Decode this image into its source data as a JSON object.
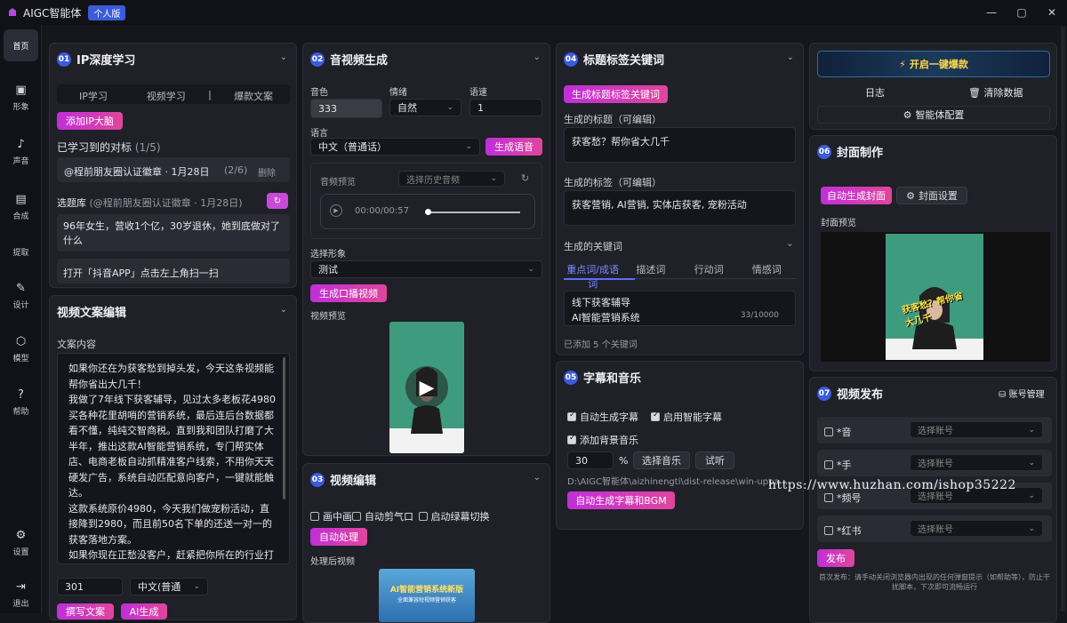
{
  "app": {
    "title": "AIGC智能体",
    "edition": "个人版"
  },
  "sidebar": {
    "items": [
      {
        "label": "首页",
        "icon": "home-icon"
      },
      {
        "label": "形象",
        "icon": "avatar-icon"
      },
      {
        "label": "声音",
        "icon": "sound-icon"
      },
      {
        "label": "合成",
        "icon": "compose-icon"
      },
      {
        "label": "提取",
        "icon": "extract-icon"
      },
      {
        "label": "设计",
        "icon": "pen-icon"
      },
      {
        "label": "模型",
        "icon": "cube-icon"
      },
      {
        "label": "帮助",
        "icon": "help-icon"
      },
      {
        "label": "设置",
        "icon": "gear-icon"
      },
      {
        "label": "退出",
        "icon": "logout-icon"
      }
    ]
  },
  "ip": {
    "num": "01",
    "title": "IP深度学习",
    "tabs": [
      "IP学习",
      "视频学习",
      "|",
      "爆款文案"
    ],
    "add_button": "添加IP大脑",
    "target_label": "已学习到的对标",
    "target_count": "(1/5)",
    "target_item": "@程前朋友圈认证徽章 · 1月28日",
    "target_progress": "(2/6)",
    "delete_label": "删除",
    "topic_label": "选题库",
    "topic_source": "(@程前朋友圈认证徽章 · 1月28日)",
    "topic_1": "96年女生，营收1个亿，30岁退休，她到底做对了什么",
    "topic_2": "打开「抖音APP」点击左上角扫一扫"
  },
  "copy_edit": {
    "title": "视频文案编辑",
    "content_label": "文案内容",
    "content": "如果你还在为获客愁到掉头发，今天这条视频能帮你省出大几千！\n我做了7年线下获客辅导，见过太多老板花4980买各种花里胡哨的营销系统，最后连后台数据都看不懂，纯纯交智商税。直到我和团队打磨了大半年，推出这款AI智能营销系统，专门帮实体店、电商老板自动抓精准客户线索，不用你天天硬发广告，系统自动匹配意向客户，一键就能触达。\n这款系统原价4980，今天我们做宠粉活动，直接降到2980，而且前50名下单的还送一对一的获客落地方案。\n如果你现在正愁没客户，赶紧把你所在的行业打在评论区，我帮你看看能不能用得上。点赞关注收藏，不然刷着刷着就找不到了，活动就这三天，错",
    "word_count": "301",
    "lang": "中文(普通",
    "btn_rewrite": "撰写文案",
    "btn_ai": "AI生成"
  },
  "av": {
    "num": "02",
    "title": "音视频生成",
    "voice_label": "音色",
    "voice_value": "333",
    "emotion_label": "情绪",
    "emotion_value": "自然",
    "speed_label": "语速",
    "speed_value": "1",
    "lang_label": "语言",
    "lang_value": "中文（普通话）",
    "gen_voice_btn": "生成语音",
    "preview_label": "音频预览",
    "history_placeholder": "选择历史音频",
    "time": "00:00/00:57",
    "avatar_label": "选择形象",
    "avatar_value": "测试",
    "gen_video_btn": "生成口播视频",
    "video_preview_label": "视频预览"
  },
  "vedit": {
    "num": "03",
    "title": "视频编辑",
    "opt_pip": "画中画",
    "opt_breath": "自动剪气口",
    "opt_green": "启动绿幕切换",
    "process_btn": "自动处理",
    "processed_label": "处理后视频",
    "thumb_line1": "AI智能营销系统新版",
    "thumb_line2": "全面兼容短视频营销获客"
  },
  "tags": {
    "num": "04",
    "title": "标题标签关键词",
    "gen_btn": "生成标题标签关键词",
    "title_label": "生成的标题（可编辑）",
    "title_value": "获客愁？帮你省大几千",
    "tags_label": "生成的标签（可编辑）",
    "tags_value": "获客营销, AI营销, 实体店获客, 宠粉活动",
    "kw_label": "生成的关键词",
    "kw_tabs": [
      "重点词/成语词",
      "描述词",
      "行动词",
      "情感词"
    ],
    "kw_lines": [
      "线下获客辅导",
      "AI智能营销系统"
    ],
    "kw_count": "33/10000",
    "kw_added": "已添加 5 个关键词"
  },
  "subs": {
    "num": "05",
    "title": "字幕和音乐",
    "auto_subs": "自动生成字幕",
    "smart_fx": "启用智能字幕",
    "bg_music": "添加背景音乐",
    "volume": "30",
    "percent": "%",
    "choose_music": "选择音乐",
    "listen": "试听",
    "path": "D:\\AIGC智能体\\aizhinengti\\dist-release\\win-uppa...",
    "gen_btn": "自动生成字幕和BGM"
  },
  "top": {
    "boom_btn": "开启一键爆款",
    "log": "日志",
    "clear": "清除数据",
    "config": "智能体配置"
  },
  "cover": {
    "num": "06",
    "title": "封面制作",
    "auto_btn": "自动生成封面",
    "settings_btn": "封面设置",
    "preview_label": "封面预览",
    "overlay_text": "获客愁？帮你省大几千"
  },
  "publish": {
    "num": "07",
    "title": "视频发布",
    "account_mgmt": "账号管理",
    "platforms": [
      "*音",
      "*手",
      "*频号",
      "*红书"
    ],
    "account_placeholder": "选择账号",
    "publish_btn": "发布",
    "note": "首次发布：请手动关闭浏览器内出现的任何弹窗提示（如帮助等），防止干扰脚本，下次即可流畅运行"
  },
  "watermark": "https://www.huzhan.com/ishop35222"
}
